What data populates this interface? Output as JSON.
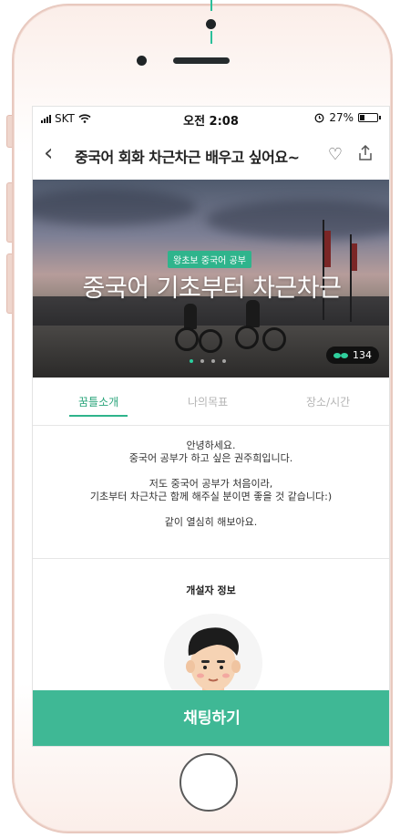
{
  "statusbar": {
    "carrier": "SKT",
    "time": "오전 2:08",
    "battery": "27%"
  },
  "navbar": {
    "title": "중국어 회화 차근차근 배우고 싶어요~"
  },
  "hero": {
    "badge": "왕초보 중국어 공부",
    "title": "중국어 기초부터 차근차근",
    "likes": "134",
    "slides": 4,
    "active_slide": 1
  },
  "tabs": [
    {
      "label": "꿈틀소개",
      "active": true
    },
    {
      "label": "나의목표",
      "active": false
    },
    {
      "label": "장소/시간",
      "active": false
    }
  ],
  "intro": {
    "line1": "안녕하세요.",
    "line2": "중국어 공부가 하고 싶은 권주희입니다.",
    "line3": "저도 중국어 공부가 처음이라,",
    "line4": "기초부터 차근차근 함께 해주실 분이면 좋을 것 같습니다:)",
    "line5": "같이 열심히 해보아요."
  },
  "host": {
    "title": "개설자 정보"
  },
  "cta": {
    "label": "채팅하기"
  },
  "colors": {
    "accent": "#3fb895",
    "tab_active": "#2aa47a"
  },
  "icons": [
    "signal-icon",
    "wifi-icon",
    "alarm-icon",
    "battery-icon",
    "back-icon",
    "heart-icon",
    "share-icon",
    "sprout-icon"
  ]
}
